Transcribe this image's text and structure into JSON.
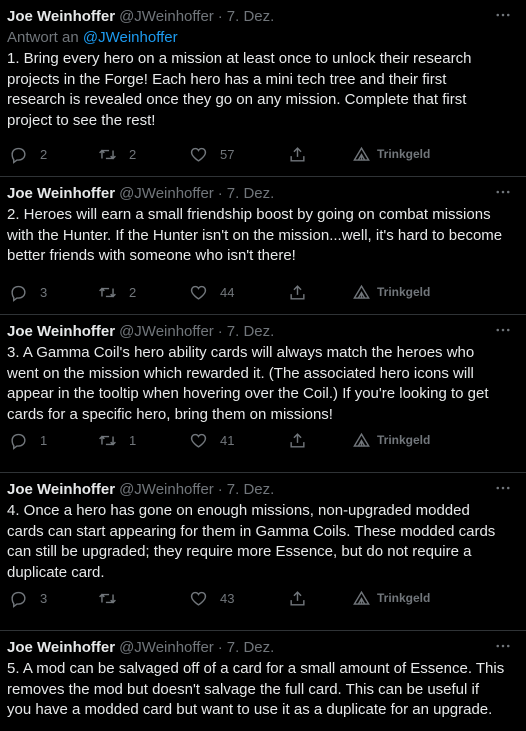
{
  "tweets": [
    {
      "name": "Joe Weinhoffer",
      "handle": "@JWeinhoffer",
      "sep": "·",
      "date": "7. Dez.",
      "reply_prefix": "Antwort an",
      "reply_mention": "@JWeinhoffer",
      "text": "1.  Bring every hero on a mission at least once to unlock their research projects in the Forge! Each hero has a mini tech tree and their first research is revealed once they go on any mission. Complete that first project to see the rest!",
      "replies": "2",
      "retweets": "2",
      "likes": "57",
      "tip": "Trinkgeld"
    },
    {
      "name": "Joe Weinhoffer",
      "handle": "@JWeinhoffer",
      "sep": "·",
      "date": "7. Dez.",
      "text": "2.  Heroes will earn a small friendship boost by going on combat missions with the Hunter. If the Hunter isn't on the mission...well, it's hard to become better friends with someone who isn't there!",
      "replies": "3",
      "retweets": "2",
      "likes": "44",
      "tip": "Trinkgeld"
    },
    {
      "name": "Joe Weinhoffer",
      "handle": "@JWeinhoffer",
      "sep": "·",
      "date": "7. Dez.",
      "text": "3.  A Gamma Coil's hero ability cards will always match the heroes who went on the mission which rewarded it. (The associated hero icons will appear in the tooltip when hovering over the Coil.) If you're looking to get cards for a specific hero, bring them on missions!",
      "replies": "1",
      "retweets": "1",
      "likes": "41",
      "tip": "Trinkgeld"
    },
    {
      "name": "Joe Weinhoffer",
      "handle": "@JWeinhoffer",
      "sep": "·",
      "date": "7. Dez.",
      "text": "4.  Once a hero has gone on enough missions, non-upgraded modded cards can start appearing for them in Gamma Coils. These modded cards can still be upgraded; they require more Essence, but do not require a duplicate card.",
      "replies": "3",
      "retweets": "",
      "likes": "43",
      "tip": "Trinkgeld"
    },
    {
      "name": "Joe Weinhoffer",
      "handle": "@JWeinhoffer",
      "sep": "·",
      "date": "7. Dez.",
      "text": "5.  A mod can be salvaged off of a card for a small amount of Essence. This removes the mod but doesn't salvage the full card. This can be useful if you have a modded card but want to use it as a duplicate for an upgrade."
    }
  ]
}
